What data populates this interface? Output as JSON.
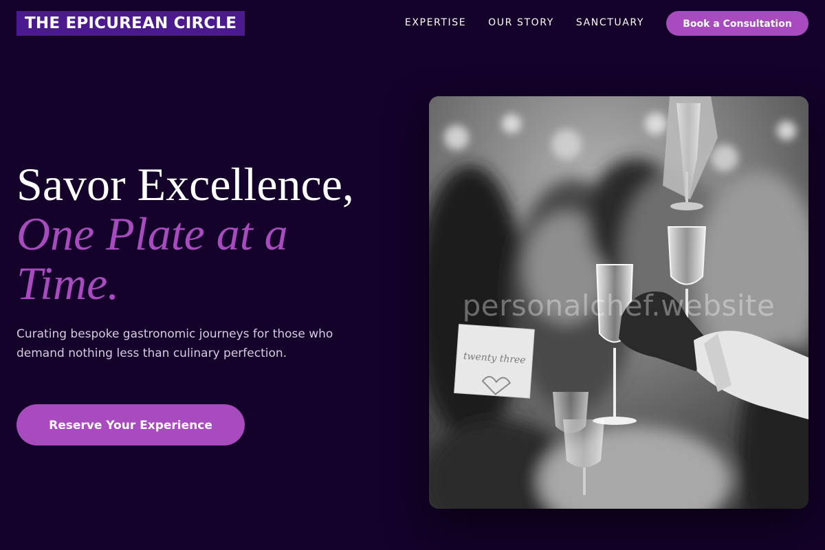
{
  "header": {
    "brand": "THE EPICUREAN CIRCLE",
    "nav": [
      {
        "label": "EXPERTISE"
      },
      {
        "label": "OUR STORY"
      },
      {
        "label": "SANCTUARY"
      }
    ],
    "cta_label": "Book a Consultation"
  },
  "hero": {
    "title_line1": "Savor Excellence,",
    "title_line2": "One Plate at a Time.",
    "subtitle": "Curating bespoke gastronomic journeys for those who demand nothing less than culinary perfection.",
    "cta_label": "Reserve Your Experience",
    "image": {
      "description_icon": "dinner-toast-photo",
      "watermark": "personalchef.website",
      "place_card_text": "twenty three"
    }
  },
  "colors": {
    "background": "#14022a",
    "accent": "#a84bbf",
    "brand_bg": "#4a1a8e",
    "text": "#ffffff",
    "muted_text": "#d6cce0"
  }
}
